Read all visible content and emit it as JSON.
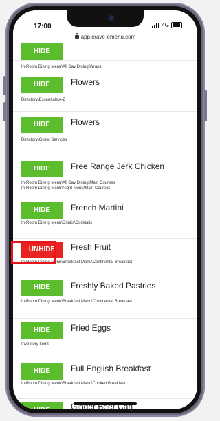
{
  "status_bar": {
    "time": "17:00",
    "network": "4G"
  },
  "browser": {
    "url": "app.crave-emenu.com"
  },
  "items": [
    {
      "button": "HIDE",
      "title": "",
      "paths": [
        "In-Room Dining Menu\\All Day Dining\\Wraps"
      ]
    },
    {
      "button": "HIDE",
      "title": "Flowers",
      "paths": [
        "Directory\\Essentials A-Z"
      ]
    },
    {
      "button": "HIDE",
      "title": "Flowers",
      "paths": [
        "Directory\\Guest Services"
      ]
    },
    {
      "button": "HIDE",
      "title": "Free Range Jerk Chicken",
      "paths": [
        "In-Room Dining Menu\\All Day Dining\\Main Courses",
        "In-Room Dining Menu\\Night Menu\\Main Courses"
      ]
    },
    {
      "button": "HIDE",
      "title": "French Martini",
      "paths": [
        "In-Room Dining Menu\\Drinks\\Cocktails"
      ]
    },
    {
      "button": "UNHIDE",
      "title": "Fresh Fruit",
      "paths": [
        "In-Room Dining Menu\\Breakfast Menu\\Continental Breakfast"
      ]
    },
    {
      "button": "HIDE",
      "title": "Freshly Baked Pastries",
      "paths": [
        "In-Room Dining Menu\\Breakfast Menu\\Continental Breakfast"
      ]
    },
    {
      "button": "HIDE",
      "title": "Fried Eggs",
      "paths": [
        "Inventory Items"
      ]
    },
    {
      "button": "HIDE",
      "title": "Full English Breakfast",
      "paths": [
        "In-Room Dining Menu\\Breakfast Menu\\Cooked Breakfast"
      ]
    },
    {
      "button": "HIDE",
      "title": "Ginger Beer Can",
      "paths": []
    }
  ],
  "colors": {
    "hide": "#5cbd2c",
    "unhide": "#e82322",
    "highlight": "#e8161b"
  }
}
